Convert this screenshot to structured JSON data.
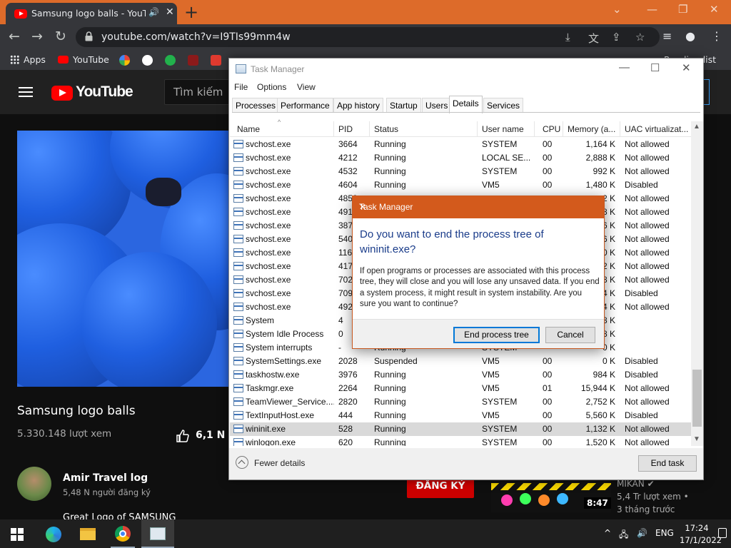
{
  "browser": {
    "tab_title": "Samsung logo balls - YouTube",
    "url": "youtube.com/watch?v=I9TIs99mm4w",
    "bookmarks": {
      "apps": "Apps",
      "youtube": "YouTube"
    },
    "reading_list": "Reading list"
  },
  "youtube": {
    "logo_text": "YouTube",
    "search_placeholder": "Tìm kiếm",
    "video_title": "Samsung logo balls",
    "views": "5.330.148 lượt xem",
    "likes": "6,1 N",
    "channel_name": "Amir Travel log",
    "subscribers": "5,48 N người đăng ký",
    "description_start": "Great Logo of SAMSUNG",
    "subscribe_label": "ĐĂNG KÝ",
    "side_video": {
      "duration": "8:47",
      "channel": "MIKAN",
      "views": "5,4 Tr lượt xem •",
      "ago": "3 tháng trước"
    }
  },
  "task_manager": {
    "title": "Task Manager",
    "menu": [
      "File",
      "Options",
      "View"
    ],
    "tabs": [
      "Processes",
      "Performance",
      "App history",
      "Startup",
      "Users",
      "Details",
      "Services"
    ],
    "active_tab": "Details",
    "columns": [
      "Name",
      "PID",
      "Status",
      "User name",
      "CPU",
      "Memory (a...",
      "UAC virtualizat..."
    ],
    "rows": [
      [
        "svchost.exe",
        "3664",
        "Running",
        "SYSTEM",
        "00",
        "1,164 K",
        "Not allowed"
      ],
      [
        "svchost.exe",
        "4212",
        "Running",
        "LOCAL SE...",
        "00",
        "2,888 K",
        "Not allowed"
      ],
      [
        "svchost.exe",
        "4532",
        "Running",
        "SYSTEM",
        "00",
        "992 K",
        "Not allowed"
      ],
      [
        "svchost.exe",
        "4604",
        "Running",
        "VM5",
        "00",
        "1,480 K",
        "Disabled"
      ],
      [
        "svchost.exe",
        "4852",
        "",
        "",
        "",
        "2 K",
        "Not allowed"
      ],
      [
        "svchost.exe",
        "4916",
        "",
        "",
        "",
        "8 K",
        "Not allowed"
      ],
      [
        "svchost.exe",
        "3872",
        "",
        "",
        "",
        "6 K",
        "Not allowed"
      ],
      [
        "svchost.exe",
        "540",
        "",
        "",
        "",
        "6 K",
        "Not allowed"
      ],
      [
        "svchost.exe",
        "1164",
        "",
        "",
        "",
        "0 K",
        "Not allowed"
      ],
      [
        "svchost.exe",
        "4172",
        "",
        "",
        "",
        "2 K",
        "Not allowed"
      ],
      [
        "svchost.exe",
        "7028",
        "",
        "",
        "",
        "8 K",
        "Not allowed"
      ],
      [
        "svchost.exe",
        "7096",
        "",
        "",
        "",
        "4 K",
        "Disabled"
      ],
      [
        "svchost.exe",
        "4928",
        "",
        "",
        "",
        "4 K",
        "Not allowed"
      ],
      [
        "System",
        "4",
        "",
        "",
        "",
        "8 K",
        ""
      ],
      [
        "System Idle Process",
        "0",
        "",
        "",
        "",
        "8 K",
        ""
      ],
      [
        "System interrupts",
        "-",
        "Running",
        "SYSTEM",
        "",
        "0 K",
        ""
      ],
      [
        "SystemSettings.exe",
        "2028",
        "Suspended",
        "VM5",
        "00",
        "0 K",
        "Disabled"
      ],
      [
        "taskhostw.exe",
        "3976",
        "Running",
        "VM5",
        "00",
        "984 K",
        "Disabled"
      ],
      [
        "Taskmgr.exe",
        "2264",
        "Running",
        "VM5",
        "01",
        "15,944 K",
        "Not allowed"
      ],
      [
        "TeamViewer_Service....",
        "2820",
        "Running",
        "SYSTEM",
        "00",
        "2,752 K",
        "Not allowed"
      ],
      [
        "TextInputHost.exe",
        "444",
        "Running",
        "VM5",
        "00",
        "5,560 K",
        "Disabled"
      ],
      [
        "wininit.exe",
        "528",
        "Running",
        "SYSTEM",
        "00",
        "1,132 K",
        "Not allowed"
      ],
      [
        "winlogon.exe",
        "620",
        "Running",
        "SYSTEM",
        "00",
        "1,520 K",
        "Not allowed"
      ]
    ],
    "selected_row": 21,
    "fewer_details": "Fewer details",
    "end_task": "End task"
  },
  "dialog": {
    "title": "Task Manager",
    "heading": "Do you want to end the process tree of wininit.exe?",
    "body": "If open programs or processes are associated with this process tree, they will close and you will lose any unsaved data. If you end a system process, it might result in system instability. Are you sure you want to continue?",
    "primary_button": "End process tree",
    "cancel_button": "Cancel"
  },
  "taskbar": {
    "language": "ENG",
    "time": "17:24",
    "date": "17/1/2022"
  },
  "colors": {
    "tab_strip": "#dd6b2a",
    "dialog_titlebar": "#d35a1c",
    "dialog_heading": "#1a3c8a",
    "youtube_red": "#ff0000"
  }
}
